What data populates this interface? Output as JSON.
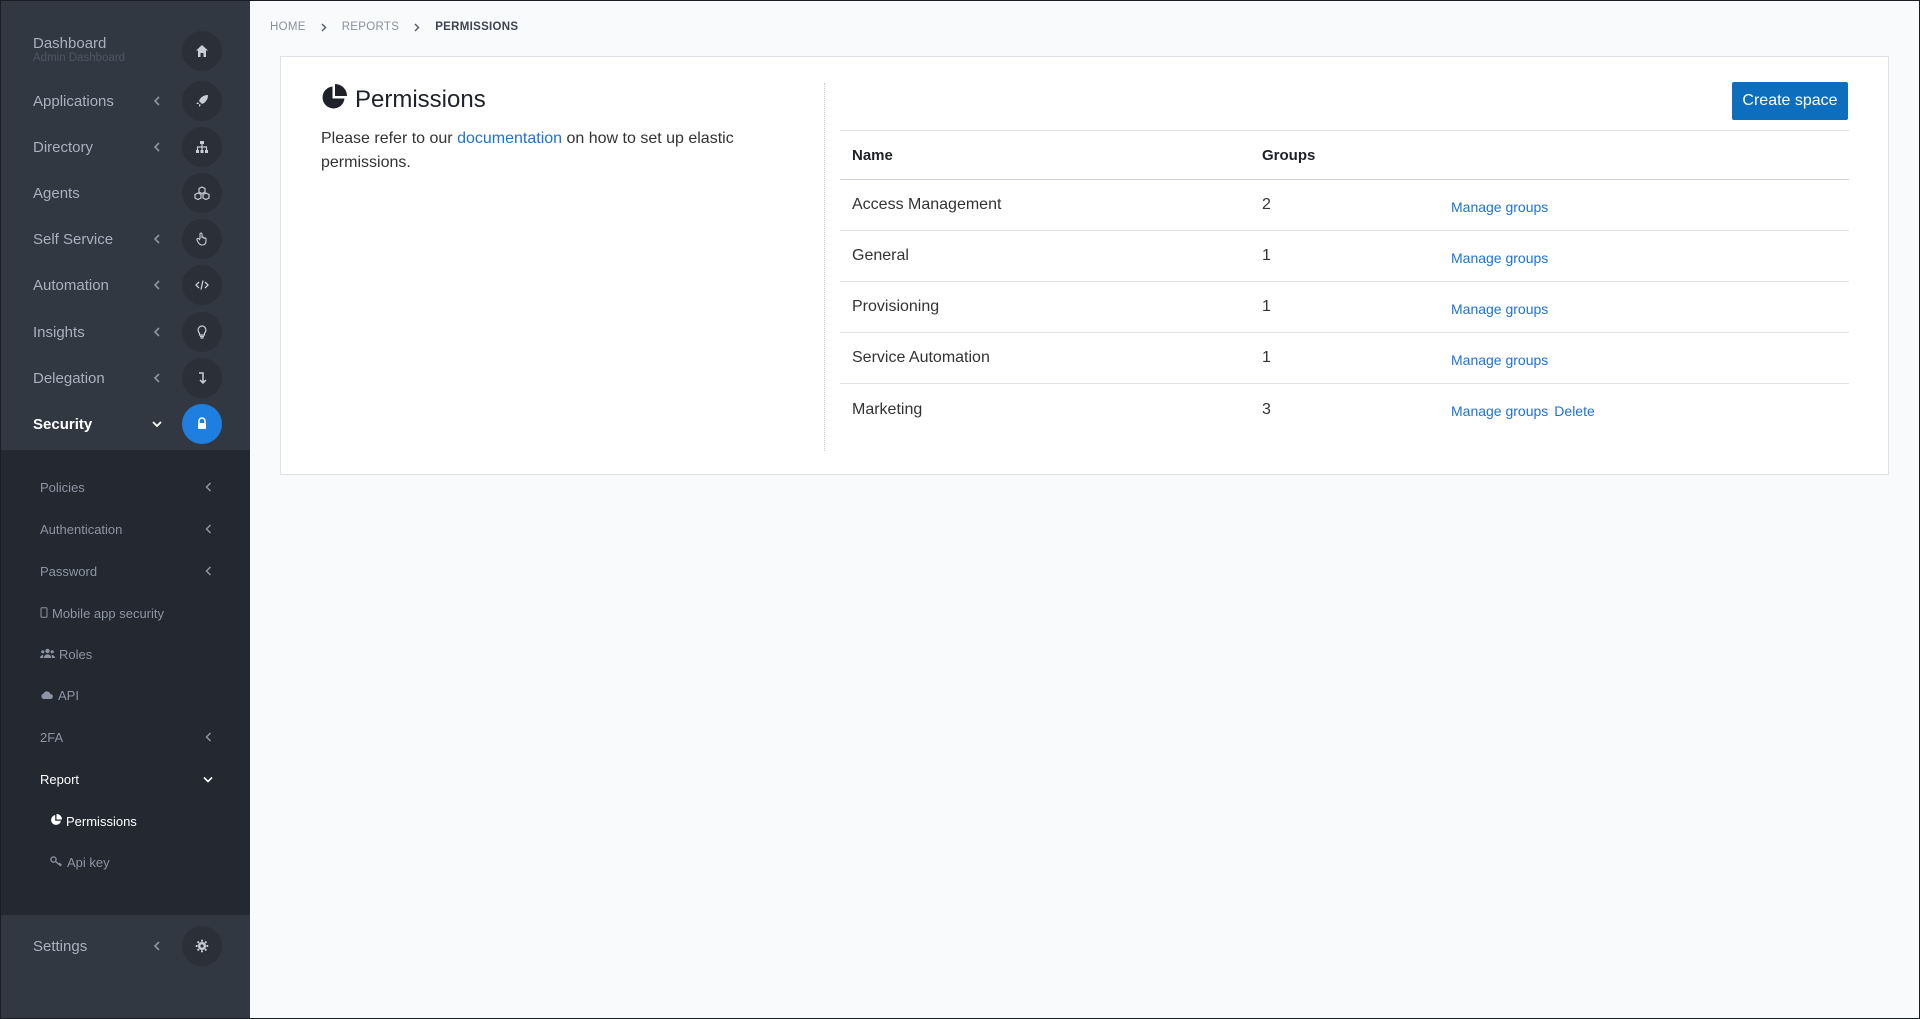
{
  "sidebar": {
    "items": [
      {
        "label": "Dashboard",
        "sub": "Admin Dashboard",
        "icon": "home-icon"
      },
      {
        "label": "Applications",
        "icon": "rocket-icon"
      },
      {
        "label": "Directory",
        "icon": "sitemap-icon"
      },
      {
        "label": "Agents",
        "icon": "cubes-icon"
      },
      {
        "label": "Self Service",
        "icon": "hand-pointer-icon"
      },
      {
        "label": "Automation",
        "icon": "code-icon"
      },
      {
        "label": "Insights",
        "icon": "lightbulb-icon"
      },
      {
        "label": "Delegation",
        "icon": "level-down-icon"
      },
      {
        "label": "Security",
        "icon": "lock-icon"
      },
      {
        "label": "Settings",
        "icon": "gear-icon"
      }
    ],
    "security_sub": [
      {
        "label": "Policies"
      },
      {
        "label": "Authentication"
      },
      {
        "label": "Password"
      },
      {
        "label": "Mobile app security"
      },
      {
        "label": "Roles"
      },
      {
        "label": "API"
      },
      {
        "label": "2FA"
      },
      {
        "label": "Report"
      },
      {
        "label": "Permissions"
      },
      {
        "label": "Api key"
      }
    ]
  },
  "breadcrumb": [
    "HOME",
    "REPORTS",
    "PERMISSIONS"
  ],
  "page": {
    "title": "Permissions",
    "intro_before": "Please refer to our ",
    "intro_link": "documentation",
    "intro_after": " on how to set up elastic permissions.",
    "create_button": "Create space"
  },
  "table": {
    "headers": {
      "name": "Name",
      "groups": "Groups"
    },
    "rows": [
      {
        "name": "Access Management",
        "groups": "2",
        "manage": "Manage groups"
      },
      {
        "name": "General",
        "groups": "1",
        "manage": "Manage groups"
      },
      {
        "name": "Provisioning",
        "groups": "1",
        "manage": "Manage groups"
      },
      {
        "name": "Service Automation",
        "groups": "1",
        "manage": "Manage groups"
      },
      {
        "name": "Marketing",
        "groups": "3",
        "manage": "Manage groups",
        "delete": "Delete"
      }
    ]
  },
  "colors": {
    "sidebar_bg": "#323842",
    "subnav_bg": "#242830",
    "accent": "#1f7fe0",
    "button": "#0c6ebd",
    "link": "#1d72d9"
  }
}
